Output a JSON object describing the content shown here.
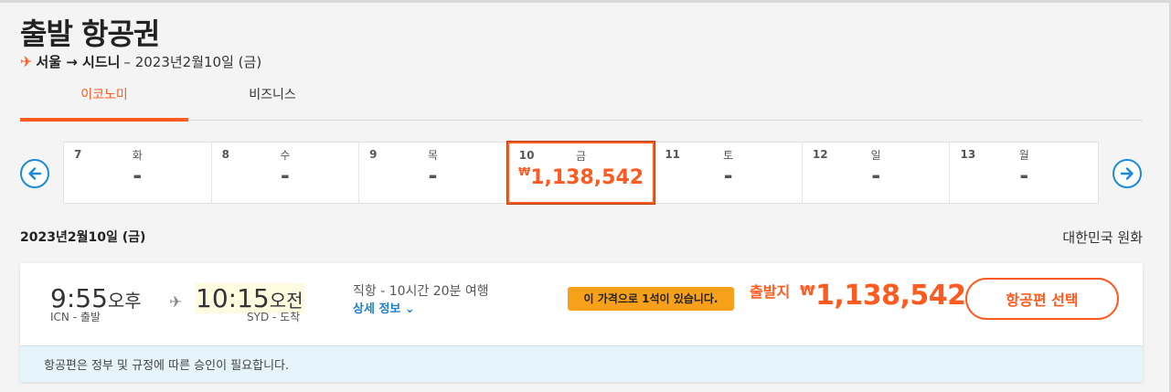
{
  "header": {
    "title": "출발 항공권",
    "route_cities": "서울 → 시드니",
    "route_date": "– 2023년2월10일 (금)"
  },
  "tabs": [
    {
      "label": "이코노미",
      "active": true
    },
    {
      "label": "비즈니스",
      "active": false
    }
  ],
  "dates": [
    {
      "num": "7",
      "day": "화",
      "price": "-"
    },
    {
      "num": "8",
      "day": "수",
      "price": "-"
    },
    {
      "num": "9",
      "day": "목",
      "price": "-"
    },
    {
      "num": "10",
      "day": "금",
      "currency": "₩",
      "price": "1,138,542",
      "selected": true
    },
    {
      "num": "11",
      "day": "토",
      "price": "-"
    },
    {
      "num": "12",
      "day": "일",
      "price": "-"
    },
    {
      "num": "13",
      "day": "월",
      "price": "-"
    }
  ],
  "results": {
    "date_heading": "2023년2월10일 (금)",
    "currency_label": "대한민국 원화"
  },
  "flight": {
    "departure_time": "9:55",
    "departure_ampm": "오후",
    "departure_airport": "ICN - 출발",
    "arrival_time": "10:15",
    "arrival_ampm": "오전",
    "arrival_airport": "SYD - 도착",
    "info": "직항 - 10시간 20분 여행",
    "details_label": "상세 정보 ⌄",
    "seat_badge": "이 가격으로 1석이 있습니다.",
    "from_label": "출발지",
    "currency": "₩",
    "price": "1,138,542",
    "select_label": "항공편 선택",
    "notice": "항공편은 정부 및 규정에 따른 승인이 필요합니다."
  },
  "icons": {
    "route_plane": "✈",
    "flight_plane": "✈",
    "prev": "arrow-left-circle-icon",
    "next": "arrow-right-circle-icon"
  },
  "colors": {
    "accent": "#ff5a1f",
    "link": "#1d7fc9",
    "badge": "#f7a11a",
    "notice_bg": "#e5f3fa"
  }
}
